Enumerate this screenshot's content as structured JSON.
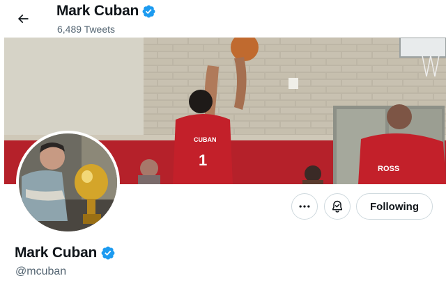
{
  "header": {
    "back_icon": "arrow-left-icon",
    "name": "Mark Cuban",
    "verified_icon": "verified-badge-icon",
    "tweet_count": "6,489 Tweets"
  },
  "banner": {
    "image": "basketball-game-photo",
    "jersey_front_text": "CUBAN",
    "jersey_front_number": "1",
    "jersey_back_text": "ROSS"
  },
  "profile": {
    "avatar": "profile-photo",
    "name": "Mark Cuban",
    "handle": "@mcuban",
    "verified_icon": "verified-badge-icon"
  },
  "actions": {
    "more_icon": "more-dots-icon",
    "notify_icon": "bell-check-icon",
    "following_label": "Following"
  },
  "colors": {
    "verified_blue": "#1d9bf0",
    "text_primary": "#0f1419",
    "text_secondary": "#536471",
    "button_border": "#cfd9de"
  }
}
